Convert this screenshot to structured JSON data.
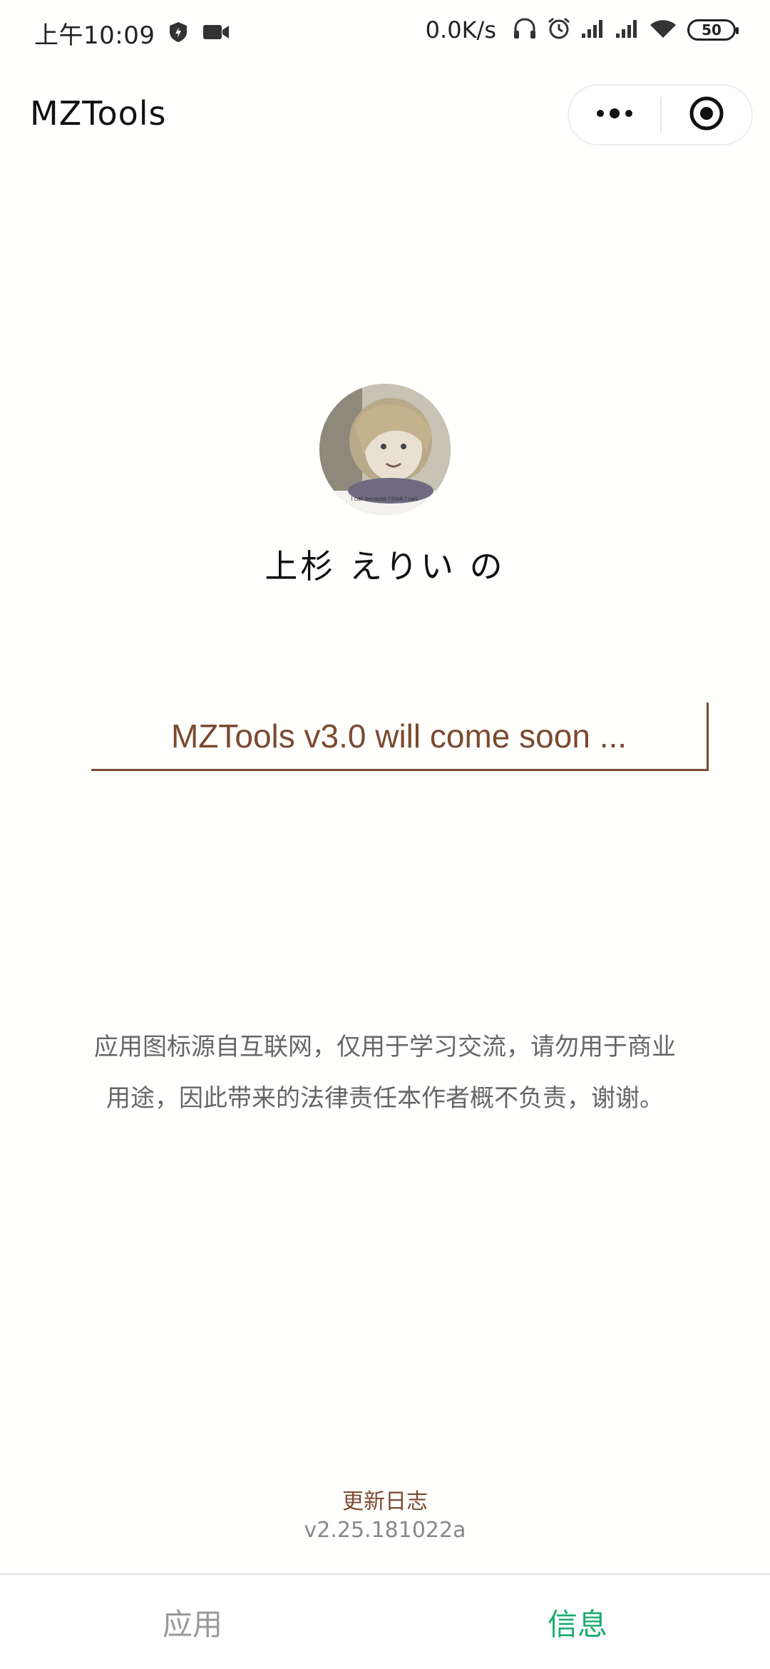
{
  "status_bar": {
    "time": "上午10:09",
    "net_speed": "0.0K/s",
    "battery": "50",
    "icons": [
      "shield-icon",
      "video-icon",
      "headphones-icon",
      "alarm-icon",
      "signal-icon",
      "signal-icon",
      "wifi-icon",
      "battery-icon"
    ]
  },
  "nav": {
    "title": "MZTools",
    "capsule": {
      "more_icon": "more-dots-icon",
      "close_icon": "target-close-icon"
    }
  },
  "profile": {
    "name": "上杉 えりい の",
    "avatar_caption": "I can because I think I can."
  },
  "notice": {
    "text": "MZTools v3.0 will come soon ..."
  },
  "disclaimer": {
    "line1": "应用图标源自互联网，仅用于学习交流，请勿用于商业",
    "line2": "用途，因此带来的法律责任本作者概不负责，谢谢。"
  },
  "footer": {
    "changelog_label": "更新日志",
    "version": "v2.25.181022a"
  },
  "tabbar": {
    "tabs": [
      {
        "label": "应用",
        "active": false
      },
      {
        "label": "信息",
        "active": true
      }
    ]
  },
  "colors": {
    "accent_brown": "#7b4a2f",
    "active_tab": "#1aad6e",
    "inactive_tab": "#999999",
    "disclaimer_text": "#666666"
  }
}
